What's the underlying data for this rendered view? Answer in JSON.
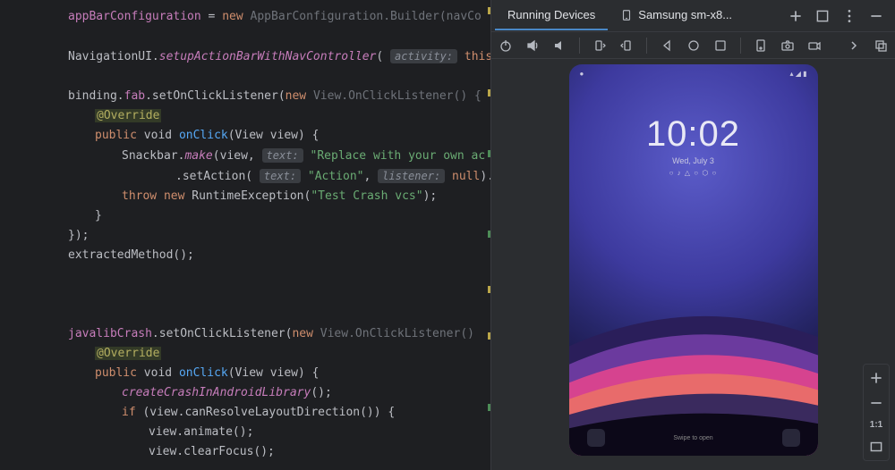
{
  "editor": {
    "l1_a": "appBarConfiguration",
    "l1_b": " = ",
    "l1_c": "new",
    "l1_d": " AppBarConfiguration.Builder(navCo",
    "l3_a": "NavigationUI.",
    "l3_b": "setupActionBarWithNavController",
    "l3_c": "( ",
    "l3_hint": "activity:",
    "l3_d": " ",
    "l3_e": "this",
    "l5_a": "binding.",
    "l5_b": "fab",
    "l5_c": ".setOnClickListener(",
    "l5_d": "new",
    "l5_e": " View.OnClickListener() {",
    "l6": "@Override",
    "l7_a": "public",
    "l7_b": " void ",
    "l7_c": "onClick",
    "l7_d": "(View view) {",
    "l8_a": "Snackbar.",
    "l8_b": "make",
    "l8_c": "(view, ",
    "l8_hint": "text:",
    "l8_d": " ",
    "l8_e": "\"Replace with your own ac",
    "l9_a": ".setAction( ",
    "l9_hint1": "text:",
    "l9_b": " ",
    "l9_c": "\"Action\"",
    "l9_d": ", ",
    "l9_hint2": "listener:",
    "l9_e": " ",
    "l9_f": "null",
    "l9_g": ").show",
    "l10_a": "throw",
    "l10_b": " ",
    "l10_c": "new",
    "l10_d": " RuntimeException(",
    "l10_e": "\"Test Crash vcs\"",
    "l10_f": ");",
    "l11": "}",
    "l12": "});",
    "l13": "extractedMethod();",
    "l14_a": "javalibCrash",
    "l14_b": ".setOnClickListener(",
    "l14_c": "new",
    "l14_d": " View.OnClickListener()",
    "l15": "@Override",
    "l16_a": "public",
    "l16_b": " void ",
    "l16_c": "onClick",
    "l16_d": "(View view) {",
    "l17_a": "createCrashInAndroidLibrary",
    "l17_b": "();",
    "l18_a": "if",
    "l18_b": " (view.canResolveLayoutDirection()) {",
    "l19": "view.animate();",
    "l20": "view.clearFocus();"
  },
  "tabs": {
    "running": "Running Devices",
    "device": "Samsung sm-x8..."
  },
  "device": {
    "time": "10:02",
    "date": "Wed, July 3",
    "dots": "○ ♪ △ ○ ⬡ ○"
  },
  "zoom": {
    "label": "1:1"
  }
}
